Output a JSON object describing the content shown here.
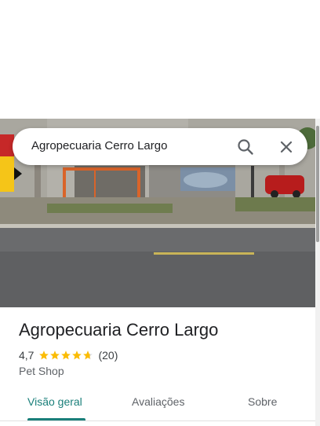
{
  "search": {
    "query": "Agropecuaria Cerro Largo",
    "search_icon": "search-icon",
    "close_icon": "close-icon"
  },
  "place": {
    "name": "Agropecuaria Cerro Largo",
    "rating_value": "4,7",
    "rating_stars": 4.7,
    "review_count": "(20)",
    "category": "Pet Shop"
  },
  "tabs": [
    {
      "label": "Visão geral",
      "active": true
    },
    {
      "label": "Avaliações",
      "active": false
    },
    {
      "label": "Sobre",
      "active": false
    }
  ],
  "colors": {
    "accent": "#1a7f7a",
    "star": "#fbbc04"
  }
}
